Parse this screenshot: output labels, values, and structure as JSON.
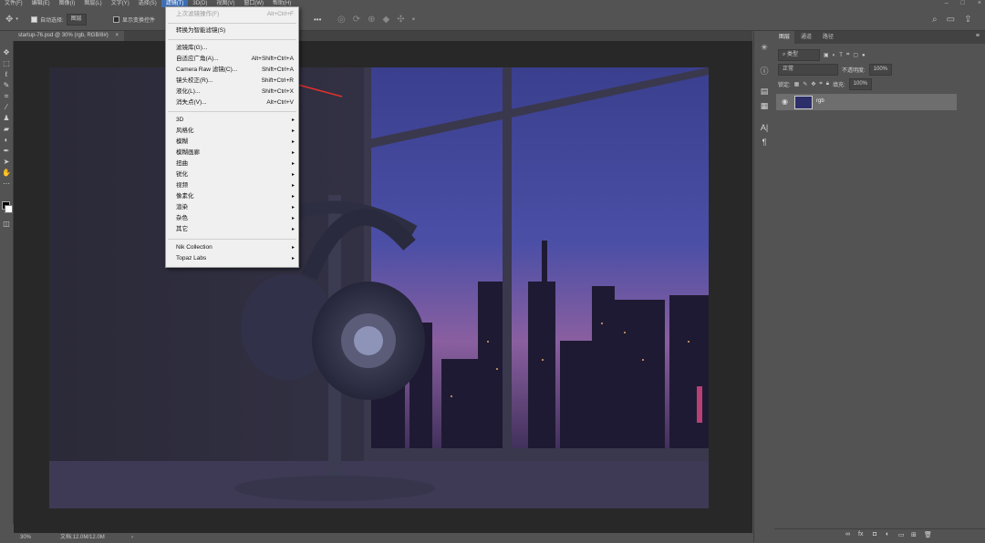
{
  "menubar": {
    "items": [
      "文件(F)",
      "编辑(E)",
      "图像(I)",
      "图层(L)",
      "文字(Y)",
      "选择(S)",
      "滤镜(T)",
      "3D(D)",
      "视图(V)",
      "窗口(W)",
      "帮助(H)"
    ],
    "active_index": 6
  },
  "options": {
    "auto_select_label": "自动选择:",
    "auto_select_value": "图层",
    "show_transform_label": "显示变换控件",
    "more_glyph": "•••"
  },
  "document": {
    "tab_title": "startup-76.psd @ 30% (rgb, RGB/8#)",
    "tab_close": "×"
  },
  "status": {
    "zoom": "30%",
    "doc_info": "文档:12.0M/12.0M",
    "arrow": "›"
  },
  "filter_menu": {
    "last_filter": {
      "label": "上次滤镜操作(F)",
      "shortcut": "Alt+Ctrl+F"
    },
    "convert_smart": "转换为智能滤镜(S)",
    "group2": [
      {
        "label": "滤镜库(G)...",
        "shortcut": ""
      },
      {
        "label": "自适应广角(A)...",
        "shortcut": "Alt+Shift+Ctrl+A"
      },
      {
        "label": "Camera Raw 滤镜(C)...",
        "shortcut": "Shift+Ctrl+A"
      },
      {
        "label": "镜头校正(R)...",
        "shortcut": "Shift+Ctrl+R"
      },
      {
        "label": "液化(L)...",
        "shortcut": "Shift+Ctrl+X"
      },
      {
        "label": "消失点(V)...",
        "shortcut": "Alt+Ctrl+V"
      }
    ],
    "submenus": [
      "3D",
      "风格化",
      "模糊",
      "模糊画廊",
      "扭曲",
      "锐化",
      "视频",
      "像素化",
      "渲染",
      "杂色",
      "其它"
    ],
    "plugins": [
      "Nik Collection",
      "Topaz Labs"
    ],
    "arrow_glyph": "▸"
  },
  "panel": {
    "tabs": [
      "图层",
      "通道",
      "路径"
    ],
    "kind_label": "类型",
    "blend_mode": "正常",
    "opacity_label": "不透明度:",
    "opacity_value": "100%",
    "lock_label": "锁定:",
    "fill_label": "填充:",
    "fill_value": "100%",
    "layer_name": "rgb",
    "bottom_icons": [
      "link-icon",
      "fx-icon",
      "mask-icon",
      "adjustment-icon",
      "group-icon",
      "new-layer-icon",
      "trash-icon"
    ]
  },
  "colors": {
    "ui_bg": "#535353",
    "menu_highlight": "#3d6fb6",
    "annotation_arrow": "#e0302a"
  }
}
